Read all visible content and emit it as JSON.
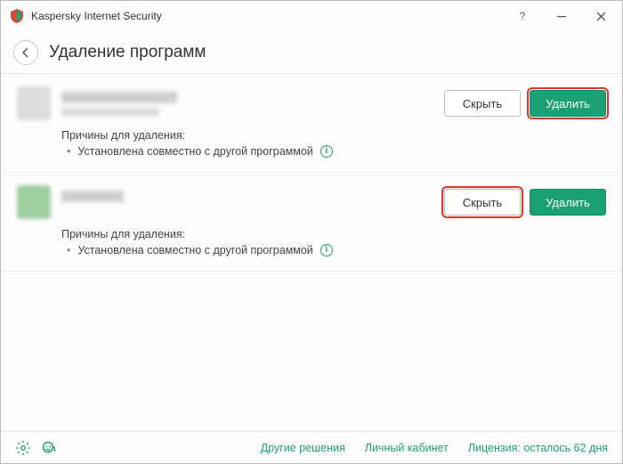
{
  "window_title": "Kaspersky Internet Security",
  "page_title": "Удаление программ",
  "buttons": {
    "hide": "Скрыть",
    "remove": "Удалить"
  },
  "reasons_label": "Причины для удаления:",
  "reason_text": "Установлена совместно с другой программой",
  "footer": {
    "other_solutions": "Другие решения",
    "my_account": "Личный кабинет",
    "license": "Лицензия: осталось 62 дня"
  }
}
